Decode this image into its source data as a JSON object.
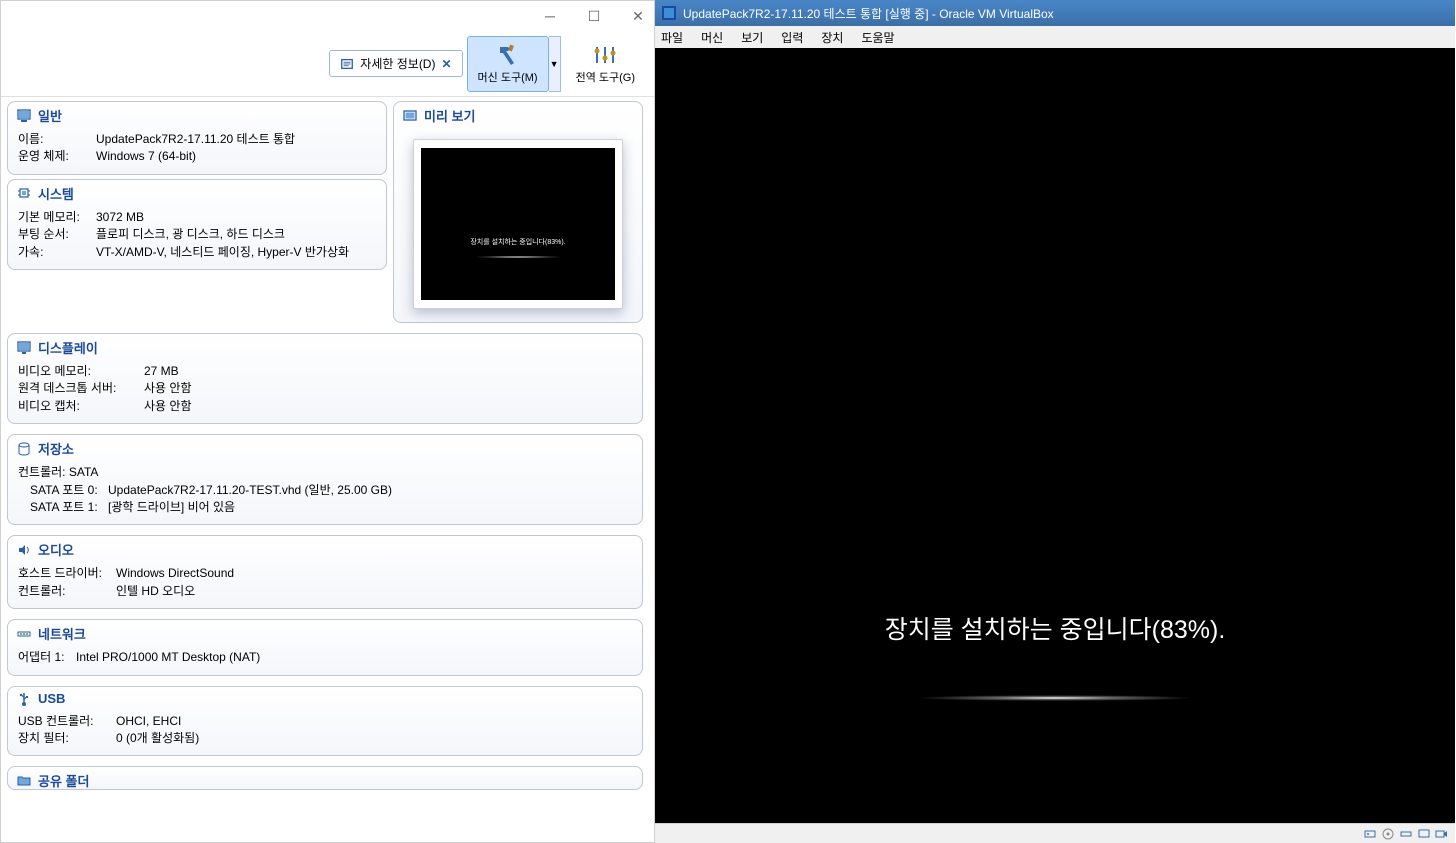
{
  "left": {
    "toolbar": {
      "detail_label": "자세한 정보(D)",
      "detail_close": "✕",
      "machine_tools": "머신 도구(M)",
      "global_tools": "전역 도구(G)"
    },
    "sections": {
      "general": {
        "title": "일반",
        "name_label": "이름:",
        "name_value": "UpdatePack7R2-17.11.20 테스트 통합",
        "os_label": "운영 체제:",
        "os_value": "Windows 7 (64-bit)"
      },
      "system": {
        "title": "시스템",
        "memory_label": "기본 메모리:",
        "memory_value": "3072 MB",
        "boot_label": "부팅 순서:",
        "boot_value": "플로피 디스크, 광 디스크, 하드 디스크",
        "accel_label": "가속:",
        "accel_value": "VT-X/AMD-V, 네스티드 페이징, Hyper-V 반가상화"
      },
      "preview": {
        "title": "미리 보기",
        "thumb_text": "장치를 설치하는 중입니다(83%)."
      },
      "display": {
        "title": "디스플레이",
        "video_label": "비디오 메모리:",
        "video_value": "27 MB",
        "rdp_label": "원격 데스크톱 서버:",
        "rdp_value": "사용 안함",
        "capture_label": "비디오 캡처:",
        "capture_value": "사용 안함"
      },
      "storage": {
        "title": "저장소",
        "controller": "컨트롤러: SATA",
        "port0_label": "SATA 포트 0:",
        "port0_value": "UpdatePack7R2-17.11.20-TEST.vhd (일반, 25.00 GB)",
        "port1_label": "SATA 포트 1:",
        "port1_value": "[광학 드라이브] 비어 있음"
      },
      "audio": {
        "title": "오디오",
        "driver_label": "호스트 드라이버:",
        "driver_value": "Windows DirectSound",
        "controller_label": "컨트롤러:",
        "controller_value": "인텔 HD 오디오"
      },
      "network": {
        "title": "네트워크",
        "adapter_label": "어댑터 1:",
        "adapter_value": "Intel PRO/1000 MT Desktop (NAT)"
      },
      "usb": {
        "title": "USB",
        "controller_label": "USB 컨트롤러:",
        "controller_value": "OHCI, EHCI",
        "filter_label": "장치 필터:",
        "filter_value": "0 (0개 활성화됨)"
      },
      "shared": {
        "title": "공유 폴더"
      }
    }
  },
  "right": {
    "title": "UpdatePack7R2-17.11.20 테스트 통합 [실행 중] - Oracle VM VirtualBox",
    "menu": {
      "file": "파일",
      "machine": "머신",
      "view": "보기",
      "input": "입력",
      "device": "장치",
      "help": "도움말"
    },
    "install_text": "장치를 설치하는 중입니다(83%)."
  }
}
